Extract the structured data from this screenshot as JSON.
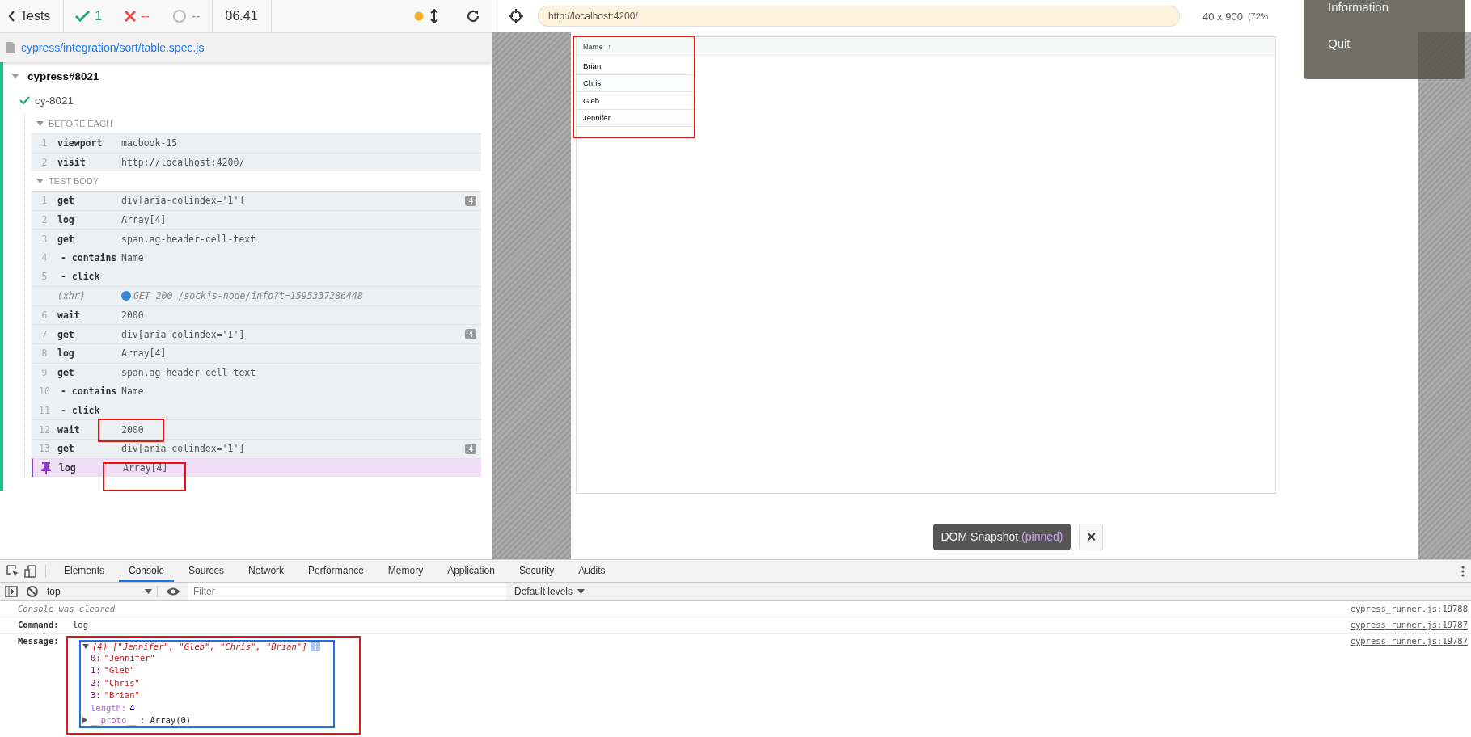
{
  "reporter": {
    "back_label": "Tests",
    "passed": "1",
    "failed": "--",
    "pending": "--",
    "duration": "06.41",
    "spec_path": "cypress/integration/sort/table.spec.js",
    "suite": {
      "title": "cypress#8021",
      "expanded": true,
      "test": {
        "title": "cy-8021",
        "passed": true,
        "hooks": [
          {
            "title": "BEFORE EACH",
            "expanded": true,
            "commands": [
              {
                "kind": "command",
                "number": "1",
                "name": "viewport",
                "message": "macbook-15"
              },
              {
                "kind": "command",
                "number": "2",
                "name": "visit",
                "message": "http://localhost:4200/"
              }
            ]
          },
          {
            "title": "TEST BODY",
            "expanded": true,
            "commands": [
              {
                "kind": "command",
                "number": "1",
                "name": "get",
                "message": "div[aria-colindex='1']",
                "badge": "4"
              },
              {
                "kind": "command",
                "number": "2",
                "name": "log",
                "message": "Array[4]"
              },
              {
                "kind": "command",
                "number": "3",
                "name": "get",
                "message": "span.ag-header-cell-text"
              },
              {
                "kind": "child",
                "number": "4",
                "name": "- contains",
                "message": "Name"
              },
              {
                "kind": "child",
                "number": "5",
                "name": "- click"
              },
              {
                "kind": "xhr",
                "name": "(xhr)",
                "message": "GET 200 /sockjs-node/info?t=1595337286448"
              },
              {
                "kind": "command",
                "number": "6",
                "name": "wait",
                "message": "2000"
              },
              {
                "kind": "command",
                "number": "7",
                "name": "get",
                "message": "div[aria-colindex='1']",
                "badge": "4"
              },
              {
                "kind": "command",
                "number": "8",
                "name": "log",
                "message": "Array[4]"
              },
              {
                "kind": "command",
                "number": "9",
                "name": "get",
                "message": "span.ag-header-cell-text"
              },
              {
                "kind": "child",
                "number": "10",
                "name": "- contains",
                "message": "Name"
              },
              {
                "kind": "child",
                "number": "11",
                "name": "- click"
              },
              {
                "kind": "command",
                "number": "12",
                "name": "wait",
                "message": "2000"
              },
              {
                "kind": "command",
                "number": "13",
                "name": "get",
                "message": "div[aria-colindex='1']",
                "badge": "4"
              },
              {
                "kind": "pinned",
                "name": "log",
                "message": "Array[4]"
              }
            ]
          }
        ]
      }
    }
  },
  "preview": {
    "url": "http://localhost:4200/",
    "viewport_size": "40 x 900",
    "viewport_scale": "(72%",
    "grid": {
      "column": "Name",
      "sort_indicator": "↑",
      "rows": [
        "Brian",
        "Chris",
        "Gleb",
        "Jennifer"
      ]
    },
    "snapshot": {
      "label": "DOM Snapshot",
      "state": "(pinned)",
      "close": "×"
    },
    "menu": [
      "Information",
      "Quit"
    ]
  },
  "devtools": {
    "tabs": [
      {
        "label": "Elements",
        "selected": false
      },
      {
        "label": "Console",
        "selected": true
      },
      {
        "label": "Sources",
        "selected": false
      },
      {
        "label": "Network",
        "selected": false
      },
      {
        "label": "Performance",
        "selected": false
      },
      {
        "label": "Memory",
        "selected": false
      },
      {
        "label": "Application",
        "selected": false
      },
      {
        "label": "Security",
        "selected": false
      },
      {
        "label": "Audits",
        "selected": false
      }
    ],
    "context": "top",
    "filter_placeholder": "Filter",
    "levels": "Default levels",
    "messages": [
      {
        "kind": "info",
        "text": "Console was cleared",
        "source": "cypress_runner.js:19788"
      },
      {
        "kind": "field",
        "label": "Command:",
        "text": "log",
        "source": "cypress_runner.js:19787"
      },
      {
        "kind": "object",
        "label": "Message:",
        "text": "(4) [\"Jennifer\", \"Gleb\", \"Chris\", \"Brian\"]",
        "source": "cypress_runner.js:19787",
        "entries": [
          {
            "key": "0:",
            "value": "\"Jennifer\""
          },
          {
            "key": "1:",
            "value": "\"Gleb\""
          },
          {
            "key": "2:",
            "value": "\"Chris\""
          },
          {
            "key": "3:",
            "value": "\"Brian\""
          },
          {
            "key": "length:",
            "value": "4"
          }
        ],
        "proto": "__proto__",
        "proto_value": ": Array(0)"
      }
    ]
  }
}
